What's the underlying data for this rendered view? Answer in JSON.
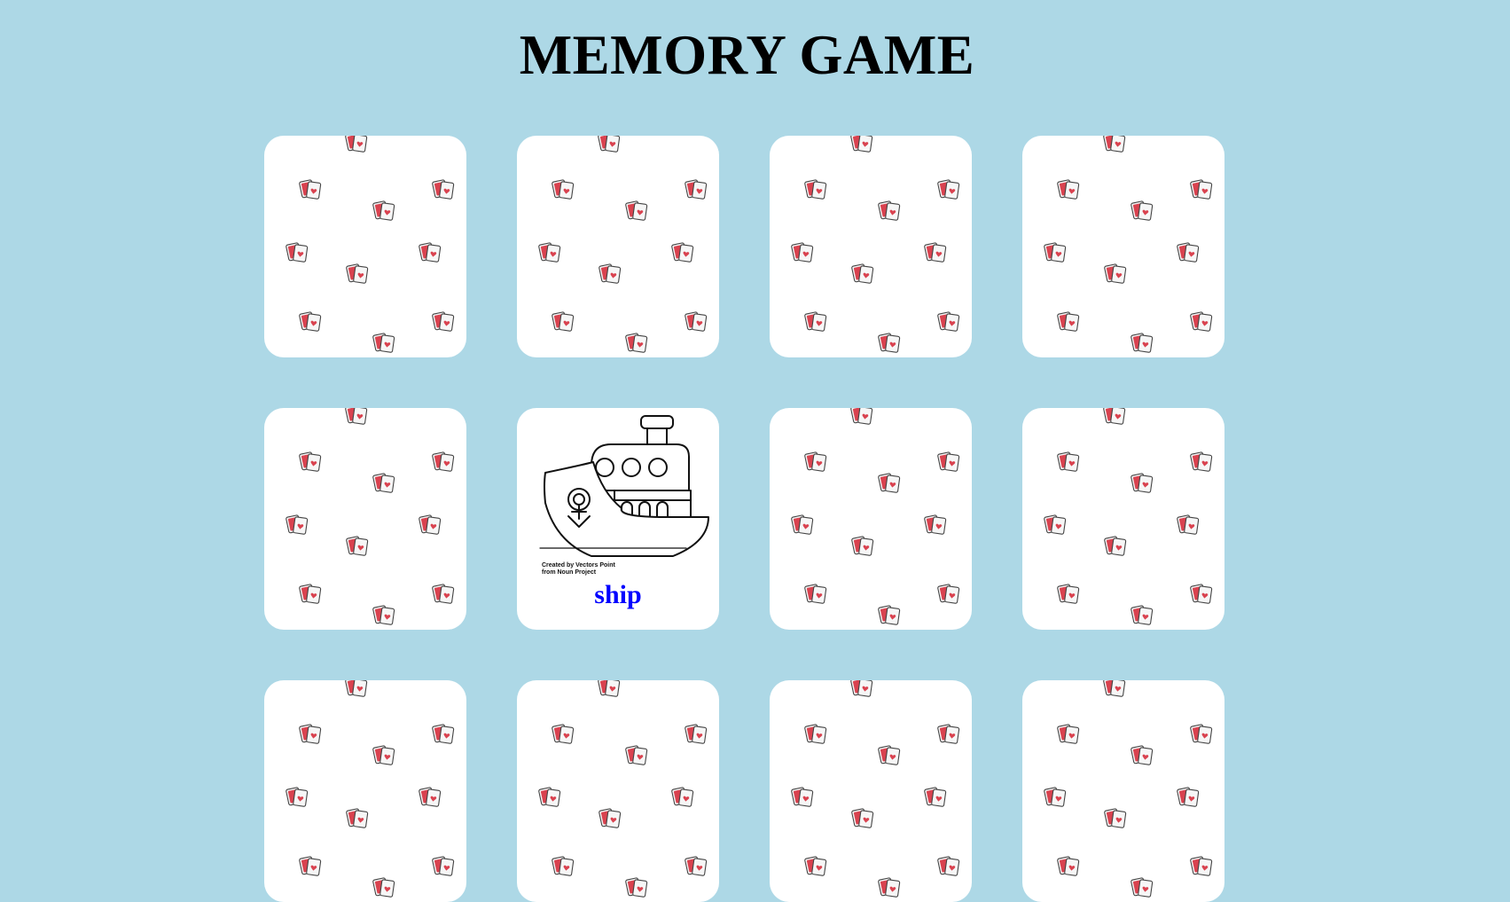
{
  "page": {
    "title": "MEMORY GAME",
    "background_color": "#add8e6"
  },
  "colors": {
    "card_face": "#ffffff",
    "card_back_icon_red": "#d9424f",
    "label_blue": "#0000ff"
  },
  "cards": [
    {
      "state": "face-down",
      "icon": "playing-cards-pattern"
    },
    {
      "state": "face-down",
      "icon": "playing-cards-pattern"
    },
    {
      "state": "face-down",
      "icon": "playing-cards-pattern"
    },
    {
      "state": "face-down",
      "icon": "playing-cards-pattern"
    },
    {
      "state": "face-down",
      "icon": "playing-cards-pattern"
    },
    {
      "state": "face-up",
      "icon": "ship-icon",
      "label": "ship",
      "credit_line1": "Created by Vectors Point",
      "credit_line2": "from Noun Project"
    },
    {
      "state": "face-down",
      "icon": "playing-cards-pattern"
    },
    {
      "state": "face-down",
      "icon": "playing-cards-pattern"
    },
    {
      "state": "face-down",
      "icon": "playing-cards-pattern"
    },
    {
      "state": "face-down",
      "icon": "playing-cards-pattern"
    },
    {
      "state": "face-down",
      "icon": "playing-cards-pattern"
    },
    {
      "state": "face-down",
      "icon": "playing-cards-pattern"
    }
  ]
}
